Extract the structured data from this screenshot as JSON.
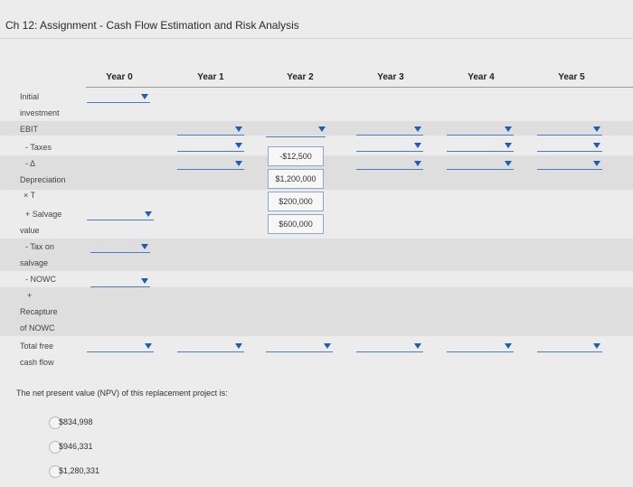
{
  "page": {
    "title": "Ch 12: Assignment - Cash Flow Estimation and Risk Analysis"
  },
  "table": {
    "years": [
      "Year 0",
      "Year 1",
      "Year 2",
      "Year 3",
      "Year 4",
      "Year 5"
    ],
    "rows": {
      "initial_investment": {
        "l1": "Initial",
        "l2": "investment"
      },
      "ebit": {
        "l1": "EBIT"
      },
      "taxes": {
        "l1": "- Taxes"
      },
      "delta": {
        "l1": "- Δ"
      },
      "depreciation": {
        "l1": "Depreciation"
      },
      "x_t": {
        "l1": "× T"
      },
      "salvage": {
        "l1": "+ Salvage",
        "l2": "value"
      },
      "tax_on_salvage": {
        "l1": "- Tax on",
        "l2": "salvage"
      },
      "nowc": {
        "l1": "- NOWC"
      },
      "recapture": {
        "l0": "+",
        "l1": "Recapture",
        "l2": "of NOWC"
      },
      "total_fcf": {
        "l1": "Total free",
        "l2": "cash flow"
      }
    },
    "year2_values": [
      "-$12,500",
      "$1,200,000",
      "$200,000",
      "$600,000"
    ]
  },
  "npv": {
    "question": "The net present value (NPV) of this replacement project is:",
    "options": [
      "$834,998",
      "$946,331",
      "$1,280,331"
    ]
  }
}
